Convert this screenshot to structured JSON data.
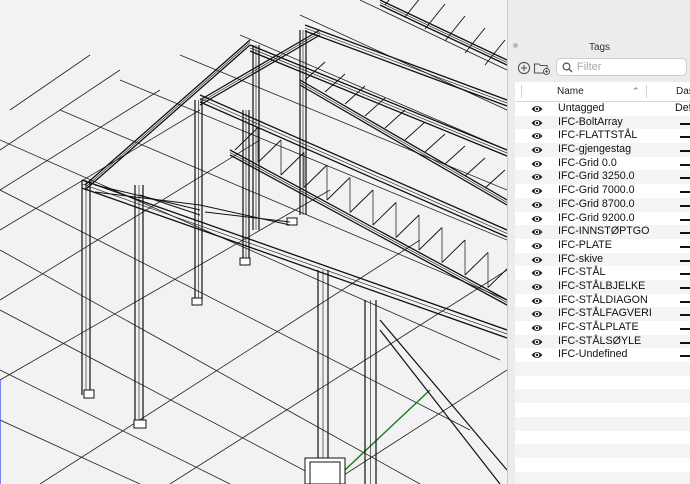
{
  "panel": {
    "title": "Tags",
    "filter_placeholder": "Filter",
    "columns": {
      "name": "Name",
      "dashes": "Das"
    },
    "sort_icon": "chevron-up-icon",
    "tags": [
      {
        "name": "Untagged",
        "dashes": "Defa"
      },
      {
        "name": "IFC-BoltArray",
        "dashes": ""
      },
      {
        "name": "IFC-FLATTSTÅL",
        "dashes": ""
      },
      {
        "name": "IFC-gjengestag",
        "dashes": ""
      },
      {
        "name": "IFC-Grid 0.0",
        "dashes": ""
      },
      {
        "name": "IFC-Grid 3250.0",
        "dashes": ""
      },
      {
        "name": "IFC-Grid 7000.0",
        "dashes": ""
      },
      {
        "name": "IFC-Grid 8700.0",
        "dashes": ""
      },
      {
        "name": "IFC-Grid 9200.0",
        "dashes": ""
      },
      {
        "name": "IFC-INNSTØPTGO",
        "dashes": ""
      },
      {
        "name": "IFC-PLATE",
        "dashes": ""
      },
      {
        "name": "IFC-skive",
        "dashes": ""
      },
      {
        "name": "IFC-STÅL",
        "dashes": ""
      },
      {
        "name": "IFC-STÅLBJELKE",
        "dashes": ""
      },
      {
        "name": "IFC-STÅLDIAGON",
        "dashes": ""
      },
      {
        "name": "IFC-STÅLFAGVERI",
        "dashes": ""
      },
      {
        "name": "IFC-STÅLPLATE",
        "dashes": ""
      },
      {
        "name": "IFC-STÅLSØYLE",
        "dashes": ""
      },
      {
        "name": "IFC-Undefined",
        "dashes": ""
      }
    ]
  },
  "viewport": {
    "background": "#f2f2f2",
    "line_color": "#111111",
    "axis_green": "#1a7a1a",
    "axis_blue": "#2a3cf0"
  }
}
